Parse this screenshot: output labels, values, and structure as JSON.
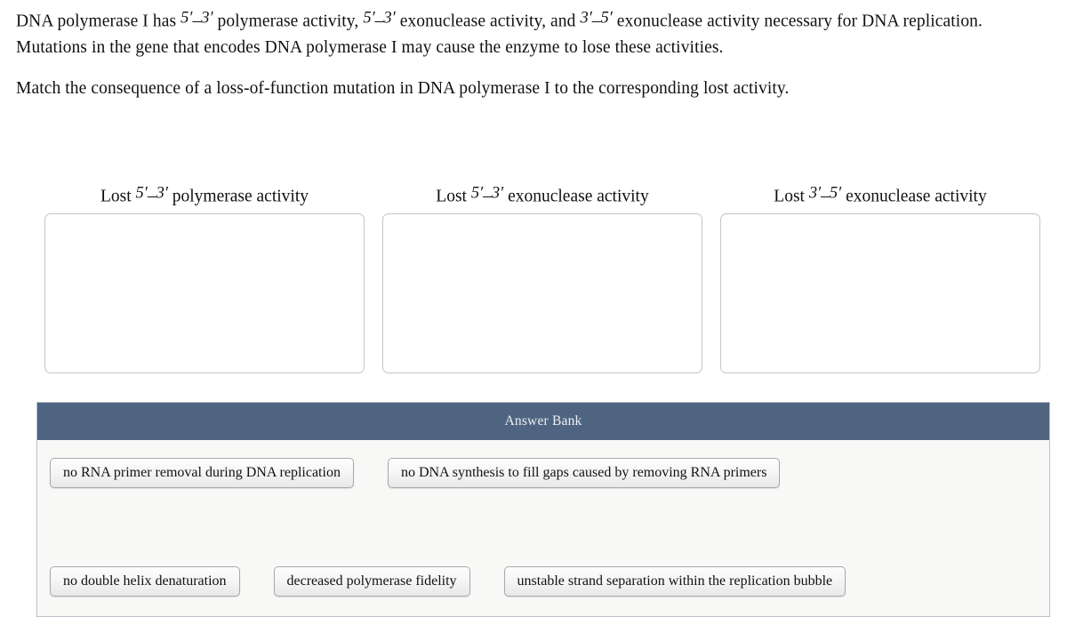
{
  "question": {
    "paragraph1_parts": [
      "DNA polymerase I has ",
      "5′–3′",
      " polymerase activity, ",
      "5′–3′",
      " exonuclease activity, and ",
      "3′–5′",
      " exonuclease activity necessary for DNA replication. Mutations in the gene that encodes DNA polymerase I may cause the enzyme to lose these activities."
    ],
    "paragraph1_text": "DNA polymerase I has 5′–3′ polymerase activity, 5′–3′ exonuclease activity, and 3′–5′ exonuclease activity necessary for DNA replication. Mutations in the gene that encodes DNA polymerase I may cause the enzyme to lose these activities.",
    "paragraph2_text": "Match the consequence of a loss-of-function mutation in DNA polymerase I to the corresponding lost activity.",
    "p1_seg1": "DNA polymerase I has ",
    "p1_prime1": "5′–3′",
    "p1_seg2": " polymerase activity, ",
    "p1_prime2": "5′–3′",
    "p1_seg3": " exonuclease activity, and ",
    "p1_prime3": "3′–5′",
    "p1_seg4": " exonuclease activity necessary for DNA replication. Mutations in the gene that encodes DNA polymerase I may cause the enzyme to lose these activities."
  },
  "columns": [
    {
      "header_text": "Lost 5′–3′ polymerase activity",
      "header_prefix": "Lost ",
      "header_prime": "5′–3′",
      "header_suffix": " polymerase activity",
      "dropped_items": []
    },
    {
      "header_text": "Lost 5′–3′ exonuclease activity",
      "header_prefix": "Lost ",
      "header_prime": "5′–3′",
      "header_suffix": " exonuclease activity",
      "dropped_items": []
    },
    {
      "header_text": "Lost 3′–5′ exonuclease activity",
      "header_prefix": "Lost ",
      "header_prime": "3′–5′",
      "header_suffix": " exonuclease activity",
      "dropped_items": []
    }
  ],
  "answer_bank": {
    "title": "Answer Bank",
    "header_color": "#4f6481",
    "body_color": "#f8f8f7",
    "items": [
      {
        "label": "no RNA primer removal during DNA replication",
        "row": 1
      },
      {
        "label": "no DNA synthesis to fill gaps caused by removing RNA primers",
        "row": 1
      },
      {
        "label": "no double helix denaturation",
        "row": 2
      },
      {
        "label": "decreased polymerase fidelity",
        "row": 2
      },
      {
        "label": "unstable strand separation within the replication bubble",
        "row": 2
      }
    ]
  }
}
